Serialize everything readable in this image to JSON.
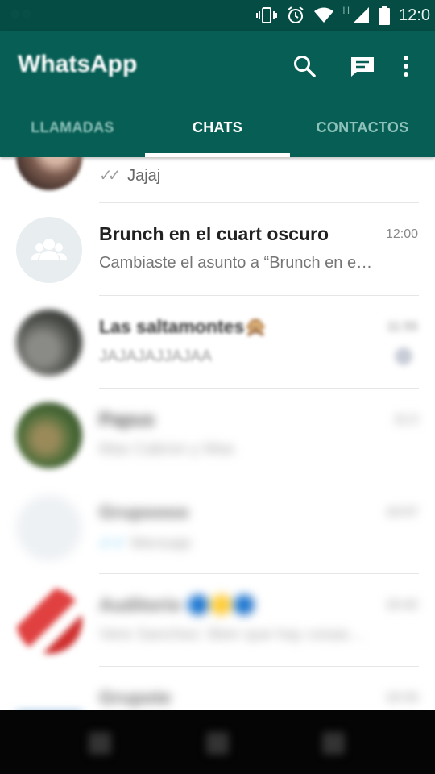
{
  "status_bar": {
    "network_type": "H",
    "time": "12:0",
    "icons": [
      "vibrate-icon",
      "alarm-icon",
      "wifi-icon",
      "cell-signal-icon",
      "battery-icon"
    ]
  },
  "app_bar": {
    "title": "WhatsApp",
    "actions": [
      "search-icon",
      "new-chat-icon",
      "more-vert-icon"
    ]
  },
  "tabs": [
    {
      "label": "LLAMADAS",
      "active": false
    },
    {
      "label": "CHATS",
      "active": true
    },
    {
      "label": "CONTACTOS",
      "active": false
    }
  ],
  "chats": [
    {
      "name": "",
      "message": "Jajaj",
      "time": "",
      "read_ticks": true
    },
    {
      "name": "Brunch en el cuart oscuro",
      "message": "Cambiaste el asunto a “Brunch en e…",
      "time": "12:00",
      "group": true
    },
    {
      "name": "Las saltamontes🙊",
      "message": "JAJAJAJJAJAA",
      "time": "11:55"
    },
    {
      "name": "Papus",
      "message": "Mas Cabron y Mas",
      "time": "11:2"
    },
    {
      "name": "Grupoooo",
      "message": "Mensaje",
      "time": "10:57"
    },
    {
      "name": "Auditorio 🔵🟡🔵",
      "message": "Vere Sanchez: Bien que hay cosas…",
      "time": "10:42"
    },
    {
      "name": "Grupote",
      "message": "",
      "time": "10:33"
    }
  ],
  "colors": {
    "primary": "#075e54",
    "status_bar": "#054d44",
    "tab_inactive": "#8dc1ba",
    "read_ticks": "#34b7f1"
  }
}
